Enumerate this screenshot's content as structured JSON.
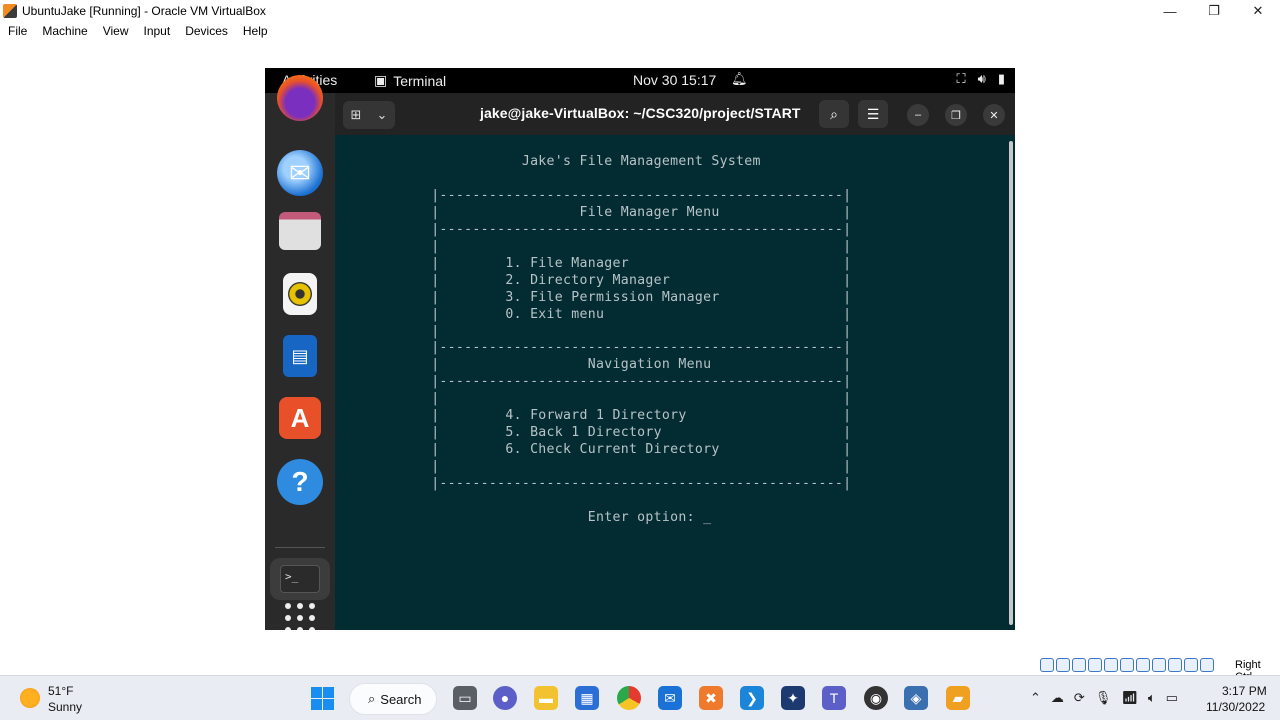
{
  "vbox": {
    "title": "UbuntuJake [Running] - Oracle VM VirtualBox",
    "menu": [
      "File",
      "Machine",
      "View",
      "Input",
      "Devices",
      "Help"
    ],
    "minimize": "—",
    "restore": "❐",
    "close": "✕",
    "host_key": "Right Ctrl"
  },
  "guest_topbar": {
    "activities": "Activities",
    "app_name": "Terminal",
    "clock": "Nov 30  15:17"
  },
  "dock": {
    "items": [
      "firefox-icon",
      "thunderbird-icon",
      "files-icon",
      "rhythmbox-icon",
      "writer-icon",
      "app-center-icon",
      "help-icon",
      "terminal-icon",
      "show-apps-icon"
    ]
  },
  "terminal": {
    "title": "jake@jake-VirtualBox: ~/CSC320/project/START",
    "lines": [
      "                Jake's File Management System",
      "",
      "     |-------------------------------------------------|",
      "     |                 File Manager Menu               |",
      "     |-------------------------------------------------|",
      "     |                                                 |",
      "     |        1. File Manager                          |",
      "     |        2. Directory Manager                     |",
      "     |        3. File Permission Manager               |",
      "     |        0. Exit menu                             |",
      "     |                                                 |",
      "     |-------------------------------------------------|",
      "     |                  Navigation Menu                |",
      "     |-------------------------------------------------|",
      "     |                                                 |",
      "     |        4. Forward 1 Directory                   |",
      "     |        5. Back 1 Directory                      |",
      "     |        6. Check Current Directory               |",
      "     |                                                 |",
      "     |-------------------------------------------------|",
      "",
      "                        Enter option: _"
    ]
  },
  "taskbar": {
    "temp": "51°F",
    "condition": "Sunny",
    "search": "Search",
    "time": "3:17 PM",
    "date": "11/30/2022",
    "colors": {
      "start": "#1a8ef0",
      "terminal_bg": "#022b32"
    }
  }
}
